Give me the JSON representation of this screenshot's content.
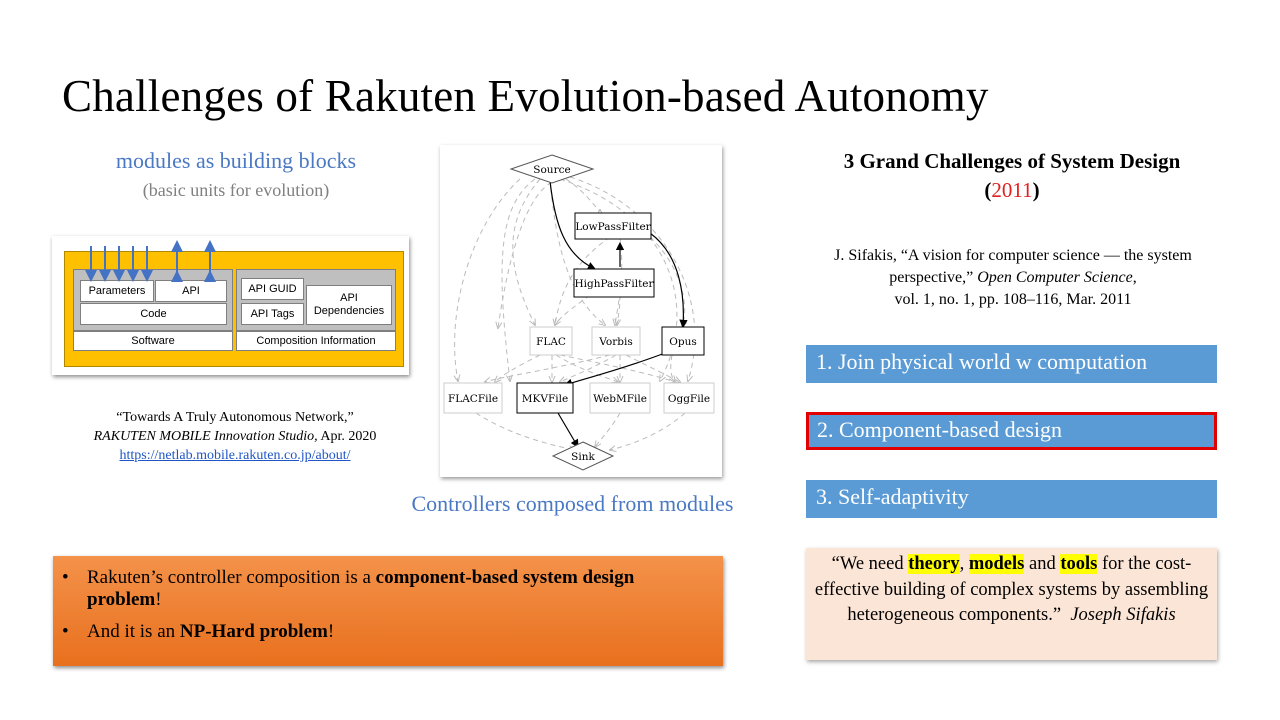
{
  "title": "Challenges of Rakuten Evolution-based Autonomy",
  "modules": {
    "subtitle": "modules as building blocks",
    "subtitle2": "(basic units for evolution)",
    "diagram": {
      "parameters": "Parameters",
      "api": "API",
      "code": "Code",
      "software": "Software",
      "api_guid": "API GUID",
      "api_tags": "API Tags",
      "api_dependencies": "API Dependencies",
      "composition_information": "Composition Information"
    }
  },
  "reference1": {
    "line1": "“Towards A Truly Autonomous Network,”",
    "line2_italic": "RAKUTEN MOBILE Innovation Studio,",
    "line2_rest": " Apr. 2020",
    "link": "https://netlab.mobile.rakuten.co.jp/about/"
  },
  "graph": {
    "nodes": {
      "source": "Source",
      "lowpass": "LowPassFilter",
      "highpass": "HighPassFilter",
      "flac": "FLAC",
      "vorbis": "Vorbis",
      "opus": "Opus",
      "flacfile": "FLACFile",
      "mkvfile": "MKVFile",
      "webmfile": "WebMFile",
      "oggfile": "OggFile",
      "sink": "Sink"
    },
    "caption": "Controllers composed from modules"
  },
  "bullets": {
    "b1_pre": "Rakuten’s controller composition is a ",
    "b1_bold": "component-based system design problem",
    "b1_post": "!",
    "b2_pre": "And it is an ",
    "b2_bold": "NP-Hard problem",
    "b2_post": "!"
  },
  "grand_challenges": {
    "title": "3 Grand Challenges of System Design",
    "year": "2011",
    "ref_line1": "J. Sifakis, “A vision for computer science — the system perspective,”",
    "ref_journal": "Open Computer Science",
    "ref_line3": "vol. 1, no. 1, pp. 108–116, Mar. 2011",
    "items": [
      "1. Join physical world w computation",
      "2. Component-based design",
      "3. Self-adaptivity"
    ]
  },
  "quote": {
    "open": "“We need ",
    "theory": "theory",
    "comma": ", ",
    "models": "models",
    "and": " and ",
    "tools": "tools",
    "rest": " for the cost-effective building of complex systems by assembling heterogeneous components.”",
    "author": "Joseph Sifakis"
  },
  "colors": {
    "accent_blue": "#4a78c3",
    "challenge_blue": "#5b9bd5",
    "highlight_red": "#e00000",
    "orange": "#ed7d31",
    "yellow": "#ffc000"
  }
}
